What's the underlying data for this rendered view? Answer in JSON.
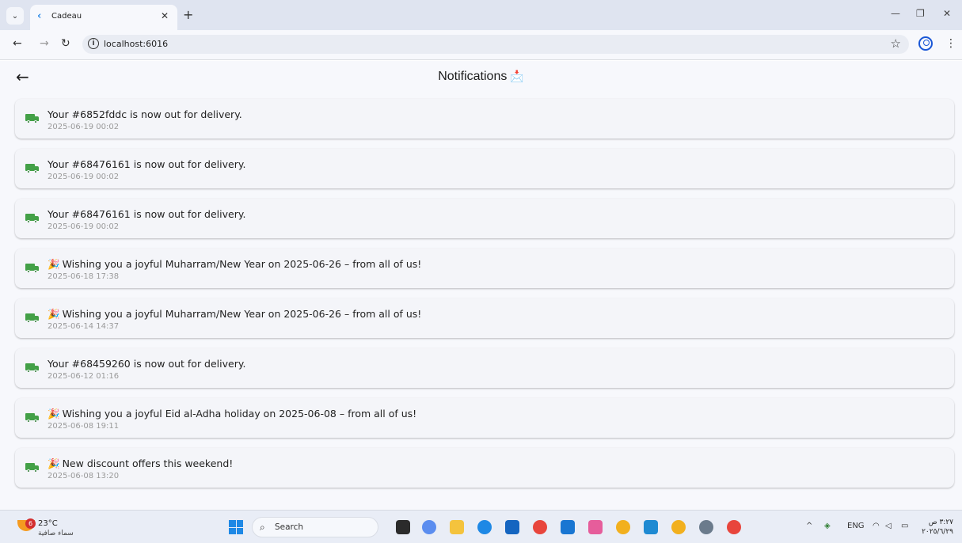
{
  "browser": {
    "tab_title": "Cadeau",
    "url": "localhost:6016"
  },
  "app": {
    "title": "Notifications",
    "title_emoji": "📩"
  },
  "notifications": [
    {
      "emoji": "",
      "message": "Your #6852fddc is now out for delivery.",
      "time": "2025-06-19 00:02"
    },
    {
      "emoji": "",
      "message": "Your #68476161 is now out for delivery.",
      "time": "2025-06-19 00:02"
    },
    {
      "emoji": "",
      "message": "Your #68476161 is now out for delivery.",
      "time": "2025-06-19 00:02"
    },
    {
      "emoji": "🎉",
      "message": "Wishing you a joyful Muharram/New Year on 2025-06-26 – from all of us!",
      "time": "2025-06-18 17:38"
    },
    {
      "emoji": "🎉",
      "message": "Wishing you a joyful Muharram/New Year on 2025-06-26 – from all of us!",
      "time": "2025-06-14 14:37"
    },
    {
      "emoji": "",
      "message": "Your #68459260 is now out for delivery.",
      "time": "2025-06-12 01:16"
    },
    {
      "emoji": "🎉",
      "message": "Wishing you a joyful Eid al-Adha holiday on 2025-06-08 – from all of us!",
      "time": "2025-06-08 19:11"
    },
    {
      "emoji": "🎉",
      "message": "New discount offers this weekend!",
      "time": "2025-06-08 13:20"
    }
  ],
  "taskbar": {
    "weather_badge": "6",
    "weather_temp": "23°C",
    "weather_desc": "سماء صافية",
    "search_label": "Search",
    "language": "ENG",
    "clock_time": "٣:٢٧ ص",
    "clock_date": "٢٠٢٥/٦/٢٩"
  },
  "colors": {
    "accent_green": "#43a047",
    "app_background": "#f7f8fc"
  }
}
